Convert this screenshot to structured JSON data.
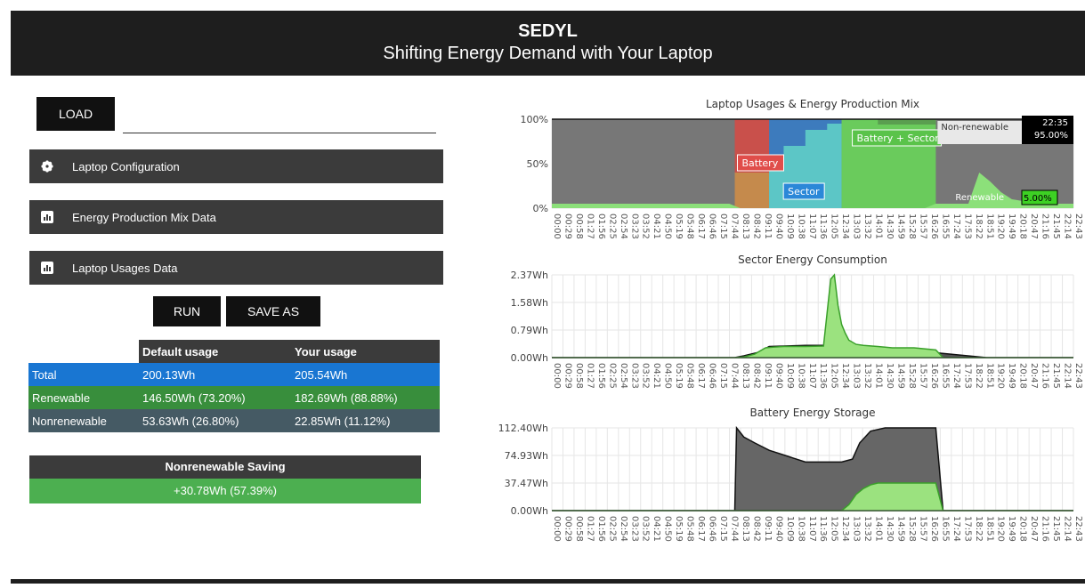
{
  "header": {
    "title": "SEDYL",
    "subtitle": "Shifting Energy Demand with Your Laptop"
  },
  "left": {
    "load_label": "LOAD",
    "sections": [
      {
        "label": "Laptop Configuration",
        "icon": "gear-icon"
      },
      {
        "label": "Energy Production Mix Data",
        "icon": "bar-chart-icon"
      },
      {
        "label": "Laptop Usages Data",
        "icon": "bar-chart-icon"
      }
    ],
    "run_label": "RUN",
    "save_label": "SAVE AS"
  },
  "stats": {
    "headers": [
      "",
      "Default usage",
      "Your usage"
    ],
    "rows": [
      {
        "label": "Total",
        "default": "200.13Wh",
        "yours": "205.54Wh",
        "color": "#1976d2"
      },
      {
        "label": "Renewable",
        "default": "146.50Wh (73.20%)",
        "yours": "182.69Wh (88.88%)",
        "color": "#388e3c"
      },
      {
        "label": "Nonrenewable",
        "default": "53.63Wh (26.80%)",
        "yours": "22.85Wh (11.12%)",
        "color": "#455a64"
      }
    ]
  },
  "saving": {
    "title": "Nonrenewable Saving",
    "value": "+30.78Wh (57.39%)"
  },
  "time_ticks": [
    "00:00",
    "00:29",
    "00:58",
    "01:27",
    "01:56",
    "02:25",
    "02:54",
    "03:23",
    "03:52",
    "04:21",
    "04:50",
    "05:19",
    "05:48",
    "06:17",
    "06:46",
    "07:15",
    "07:44",
    "08:13",
    "08:42",
    "09:11",
    "09:40",
    "10:09",
    "10:38",
    "11:07",
    "11:36",
    "12:05",
    "12:34",
    "13:03",
    "13:32",
    "14:01",
    "14:30",
    "14:59",
    "15:28",
    "15:57",
    "16:26",
    "16:55",
    "17:24",
    "17:53",
    "18:22",
    "18:51",
    "19:20",
    "19:49",
    "20:18",
    "20:47",
    "21:16",
    "21:45",
    "22:14",
    "22:43"
  ],
  "chart_data": [
    {
      "type": "area",
      "title": "Laptop Usages & Energy Production Mix",
      "y_ticks": [
        "0%",
        "50%",
        "100%"
      ],
      "ylim": [
        0,
        100
      ],
      "xlim": [
        0,
        1440
      ],
      "series": [
        {
          "name": "Non-renewable",
          "color": "#777777"
        },
        {
          "name": "Renewable",
          "color": "#7fd96b"
        }
      ],
      "renewable_percent": {
        "x": [
          0,
          190,
          220,
          250,
          280,
          310,
          340,
          370,
          400,
          430,
          460,
          490,
          520,
          550,
          580,
          610,
          640,
          670,
          700,
          730,
          760,
          790,
          820,
          850,
          880,
          910,
          940,
          970,
          1000,
          1030,
          1060,
          1090,
          1120,
          1150,
          1180,
          1210,
          1240,
          1270,
          1300,
          1330,
          1360,
          1390,
          1420,
          1440
        ],
        "y": [
          5,
          5,
          5,
          5,
          5,
          5,
          5,
          5,
          5,
          5,
          5,
          5,
          5,
          5,
          5,
          5,
          5,
          5,
          5,
          5,
          5,
          5,
          5,
          5,
          5,
          5,
          5,
          5,
          5,
          5,
          5,
          5,
          5,
          5,
          40,
          30,
          18,
          10,
          8,
          6,
          5,
          5,
          5,
          5
        ]
      },
      "annotations": [
        "Battery",
        "Sector",
        "Battery + Sector"
      ],
      "hover": {
        "time": "22:35",
        "nonrenewable": "Non-renewable",
        "nonrenewable_value": "95.00%",
        "renewable": "Renewable",
        "renewable_value": "5.00%"
      }
    },
    {
      "type": "area",
      "title": "Sector Energy Consumption",
      "y_ticks": [
        "0.00Wh",
        "0.79Wh",
        "1.58Wh",
        "2.37Wh"
      ],
      "ylim": [
        0,
        2.37
      ],
      "xlim": [
        0,
        1440
      ],
      "series": [
        {
          "name": "Non-renewable",
          "color": "#555555",
          "x": [
            0,
            505,
            530,
            570,
            600,
            700,
            780,
            800,
            840,
            900,
            1200,
            1440
          ],
          "y": [
            0,
            0,
            0.05,
            0.15,
            0.32,
            0.35,
            0.35,
            0.4,
            0.35,
            0.3,
            0,
            0
          ]
        },
        {
          "name": "Renewable",
          "color": "#9be27f",
          "x": [
            0,
            505,
            530,
            560,
            590,
            610,
            640,
            700,
            750,
            770,
            780,
            790,
            800,
            810,
            820,
            840,
            860,
            900,
            940,
            1000,
            1060,
            1080,
            1440
          ],
          "y": [
            0,
            0,
            0.02,
            0.1,
            0.28,
            0.3,
            0.32,
            0.32,
            0.33,
            2.25,
            2.37,
            1.5,
            0.95,
            0.7,
            0.5,
            0.38,
            0.35,
            0.32,
            0.28,
            0.28,
            0.22,
            0,
            0
          ]
        }
      ]
    },
    {
      "type": "area",
      "title": "Battery Energy Storage",
      "y_ticks": [
        "0.00Wh",
        "37.47Wh",
        "74.93Wh",
        "112.40Wh"
      ],
      "ylim": [
        0,
        112.4
      ],
      "xlim": [
        0,
        1440
      ],
      "series": [
        {
          "name": "Total",
          "color": "#666666",
          "x": [
            0,
            505,
            510,
            530,
            560,
            600,
            650,
            700,
            740,
            780,
            800,
            830,
            850,
            880,
            920,
            1000,
            1060,
            1080,
            1440
          ],
          "y": [
            0,
            0,
            112.4,
            100,
            92,
            82,
            74,
            66,
            66,
            66,
            66,
            70,
            92,
            108,
            112.4,
            112.4,
            112.4,
            0,
            0
          ]
        },
        {
          "name": "Renewable",
          "color": "#9be27f",
          "x": [
            0,
            505,
            800,
            820,
            840,
            860,
            880,
            900,
            940,
            1000,
            1060,
            1080,
            1440
          ],
          "y": [
            0,
            0,
            0,
            8,
            22,
            30,
            35,
            37.4,
            37.4,
            37.4,
            37.4,
            0,
            0
          ]
        }
      ]
    }
  ]
}
